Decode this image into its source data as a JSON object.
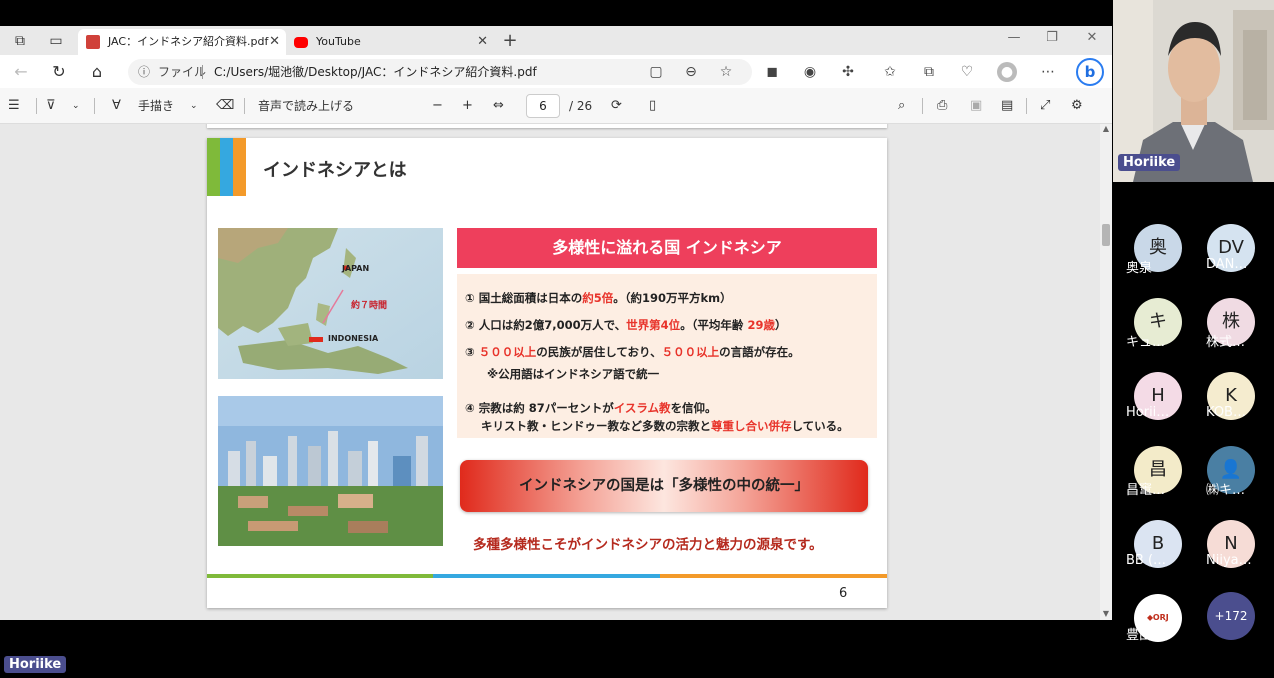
{
  "browser": {
    "tabs": [
      {
        "label": "JAC：インドネシア紹介資料.pdf",
        "icon": "pdf-icon",
        "active": true
      },
      {
        "label": "YouTube",
        "icon": "youtube-icon",
        "active": false
      }
    ],
    "address": {
      "info_label": "ファイル",
      "url": "C:/Users/堀池徹/Desktop/JAC：インドネシア紹介資料.pdf"
    },
    "bing_label": "b"
  },
  "pdf_toolbar": {
    "draw_label": "手描き",
    "read_aloud_label": "音声で読み上げる",
    "current_page": "6",
    "total_pages": "/ 26"
  },
  "slide": {
    "title": "インドネシアとは",
    "map_labels": {
      "japan": "JAPAN",
      "hours": "約７時間",
      "indonesia": "INDONESIA"
    },
    "banner": "多様性に溢れる国 インドネシア",
    "points": [
      {
        "parts": [
          "① 国土総面積は日本の",
          "約5倍",
          "。（約190万平方km）"
        ]
      },
      {
        "parts": [
          "② 人口は約2億7,000万人で、",
          "世界第4位",
          "。（平均年齢 ",
          "29歳",
          "）"
        ]
      },
      {
        "parts": [
          "③ ",
          "５００以上",
          "の民族が居住しており、",
          "５００以上",
          "の言語が存在。"
        ]
      },
      {
        "parts": [
          "※公用語はインドネシア語で統一"
        ]
      },
      {
        "parts": [
          "④ 宗教は約 87パーセントが",
          "イスラム教",
          "を信仰。"
        ]
      },
      {
        "parts": [
          "キリスト教・ヒンドゥー教など多数の宗教と",
          "尊重し合い併存",
          "している。"
        ]
      }
    ],
    "motto": "インドネシアの国是は「多様性の中の統一」",
    "tagline": "多種多様性こそがインドネシアの活力と魅力の源泉です。",
    "page_number": "6"
  },
  "meeting": {
    "speaker_name": "Horiike",
    "self_name": "Horiike",
    "participants": [
      {
        "initial": "奥",
        "name": "奥泉",
        "color": "#c9d8e8"
      },
      {
        "initial": "DV",
        "name": "DAN…",
        "color": "#d5e3f0"
      },
      {
        "initial": "キ",
        "name": "キュ…",
        "color": "#e7ecd3"
      },
      {
        "initial": "株",
        "name": "株式…",
        "color": "#f0dbe3"
      },
      {
        "initial": "H",
        "name": "Horii…",
        "color": "#f4dbe6"
      },
      {
        "initial": "K",
        "name": "KOB…",
        "color": "#f5eccf"
      },
      {
        "initial": "昌",
        "name": "昌竃…",
        "color": "#f3ebc9"
      },
      {
        "initial": "",
        "name": "㈱キ…",
        "color": "#4a7fa3"
      },
      {
        "initial": "B",
        "name": "BB (…",
        "color": "#dbe4f2"
      },
      {
        "initial": "N",
        "name": "Niiya…",
        "color": "#f6dcd6"
      },
      {
        "initial": "",
        "name": "豊田…",
        "color": "#ffffff"
      }
    ],
    "more_count": "+172"
  },
  "colors": {
    "accent_green": "#7fba3a",
    "accent_blue": "#35a8e0",
    "accent_orange": "#f39a2a",
    "banner_red": "#ee3f5c",
    "chip": "#4b4e8e"
  }
}
